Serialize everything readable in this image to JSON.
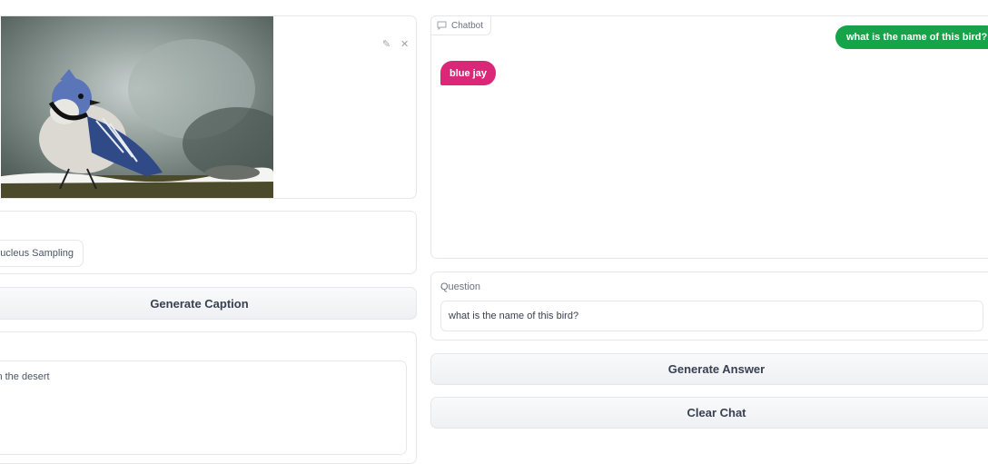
{
  "image_panel": {
    "edit_icon": "pencil-icon",
    "close_icon": "close-icon"
  },
  "options": {
    "sampling_label": "Nucleus Sampling"
  },
  "caption": {
    "button_label": "Generate Caption",
    "output_text": "in the desert"
  },
  "chatbot": {
    "label": "Chatbot",
    "messages": [
      {
        "role": "user",
        "text": "what is the name of this bird?"
      },
      {
        "role": "bot",
        "text": "blue jay"
      }
    ],
    "colors": {
      "user": "#16a34a",
      "bot": "#db2777"
    }
  },
  "question": {
    "label": "Question",
    "value": "what is the name of this bird?"
  },
  "actions": {
    "generate_answer": "Generate Answer",
    "clear_chat": "Clear Chat"
  }
}
